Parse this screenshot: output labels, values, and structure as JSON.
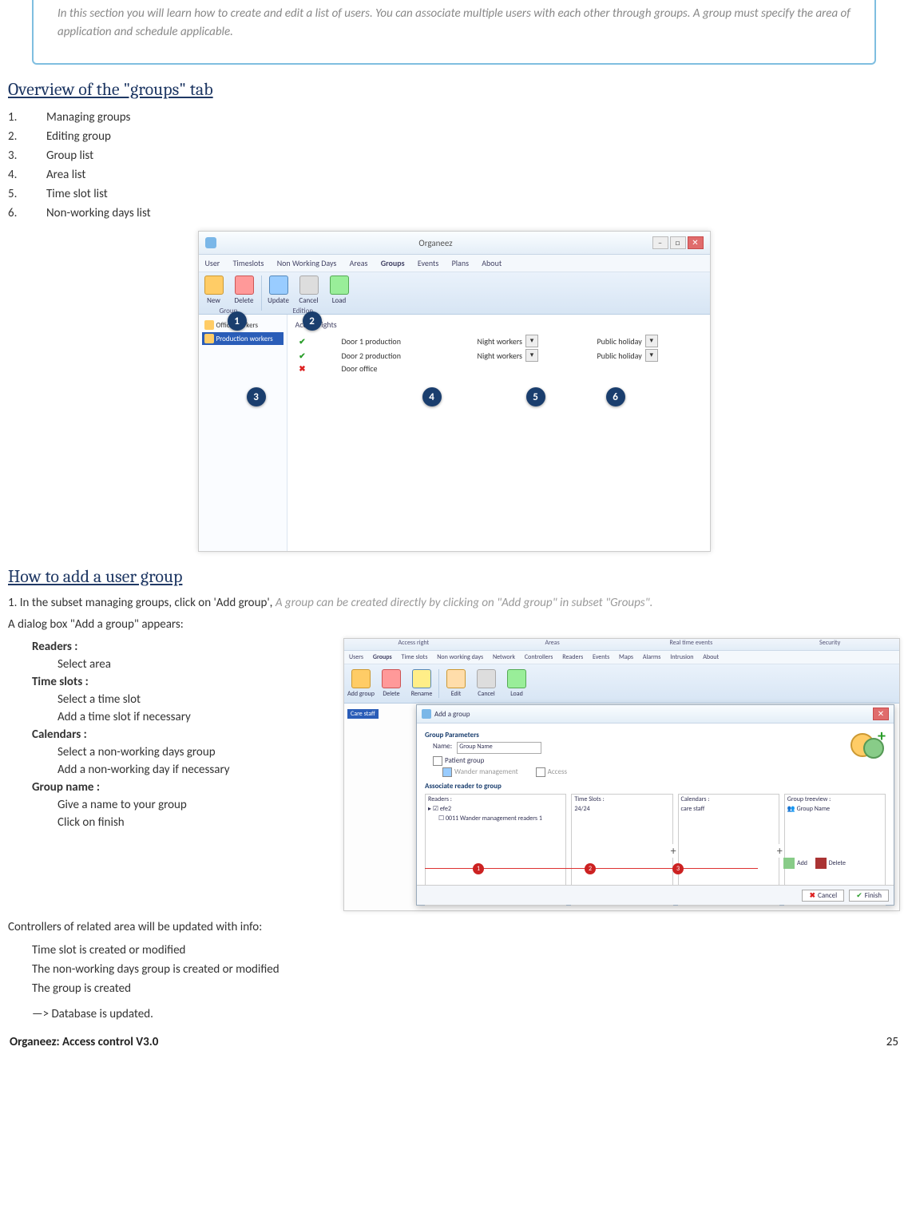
{
  "callout_text": "In this section you will learn how to create and edit a list of users. You can associate multiple users with each other through groups. A group must specify the area of application and schedule applicable.",
  "heading_overview": "Overview of the \"groups\" tab",
  "overview_items": [
    "Managing groups",
    "Editing group",
    "Group list",
    "Area list",
    "Time slot list",
    "Non-working days list"
  ],
  "fig1": {
    "window_title": "Organeez",
    "tabs": [
      "User",
      "Timeslots",
      "Non Working Days",
      "Areas",
      "Groups",
      "Events",
      "Plans",
      "About"
    ],
    "ribbon": {
      "items": [
        "New",
        "Delete",
        "Update",
        "Cancel",
        "Load"
      ],
      "group1": "Group",
      "group2": "Edition"
    },
    "side_items": [
      "Office workers",
      "Production workers"
    ],
    "main_header": "Access rights",
    "rows": [
      {
        "door": "Door 1 production",
        "ts": "Night workers",
        "cal": "Public holiday",
        "ok": true
      },
      {
        "door": "Door 2 production",
        "ts": "Night workers",
        "cal": "Public holiday",
        "ok": true
      },
      {
        "door": "Door office",
        "ok": false
      }
    ],
    "markers": [
      "1",
      "2",
      "3",
      "4",
      "5",
      "6"
    ]
  },
  "heading_add": "How to add a user group",
  "add_intro_a": "1. In the subset managing groups, click on 'Add group', ",
  "add_intro_gray": "A group can be created directly by clicking on \"Add group\" in subset \"Groups\".",
  "add_intro_b": " A dialog box \"Add a group\" appears:",
  "steps": {
    "readers_h": "Readers :",
    "readers_1": "Select  area",
    "ts_h": "Time slots :",
    "ts_1": "Select a time slot",
    "ts_2": "Add a time slot if necessary",
    "cal_h": "Calendars :",
    "cal_1": "Select a non-working days group",
    "cal_2": "Add a non-working day if necessary",
    "gn_h": "Group name :",
    "gn_1": "Give a name to your group",
    "gn_2": "Click on finish"
  },
  "fig2": {
    "topcats": [
      "Access right",
      "Areas",
      "Real time events",
      "Security"
    ],
    "tabs": [
      "Users",
      "Groups",
      "Time slots",
      "Non working days",
      "Network",
      "Controllers",
      "Readers",
      "Events",
      "Maps",
      "Alarms",
      "Intrusion",
      "About"
    ],
    "ribbon": [
      "Add group",
      "Delete",
      "Rename",
      "Edit",
      "Cancel",
      "Load"
    ],
    "side_item": "Care staff",
    "dlg_title": "Add a group",
    "sec_params": "Group Parameters",
    "name_label": "Name:",
    "name_value": "Group Name",
    "chk_patient": "Patient group",
    "chk_wander": "Wander management",
    "chk_access": "Access",
    "sec_assoc": "Associate reader to group",
    "col_readers": "Readers :",
    "col_ts": "Time Slots :",
    "col_cal": "Calendars :",
    "col_tree": "Group treeview :",
    "reader_item": "efe2",
    "reader_sub": "0011 Wander management readers 1",
    "ts_item": "24/24",
    "cal_item": "care staff",
    "tree_item": "Group Name",
    "add_timeslot": "Add timeslot",
    "add_calendar": "Add calendar",
    "btn_add": "Add",
    "btn_delete": "Delete",
    "btn_cancel": "Cancel",
    "btn_finish": "Finish",
    "rednums": [
      "1",
      "2",
      "3"
    ]
  },
  "controllers_line": "Controllers of related area will be updated with info:",
  "post_items": [
    "Time slot is created or modified",
    "The non-working days group is created or modified",
    "The group is created"
  ],
  "db_line": "—> Database is updated.",
  "footer_left": "Organeez: Access control     V3.0",
  "footer_right": "25"
}
